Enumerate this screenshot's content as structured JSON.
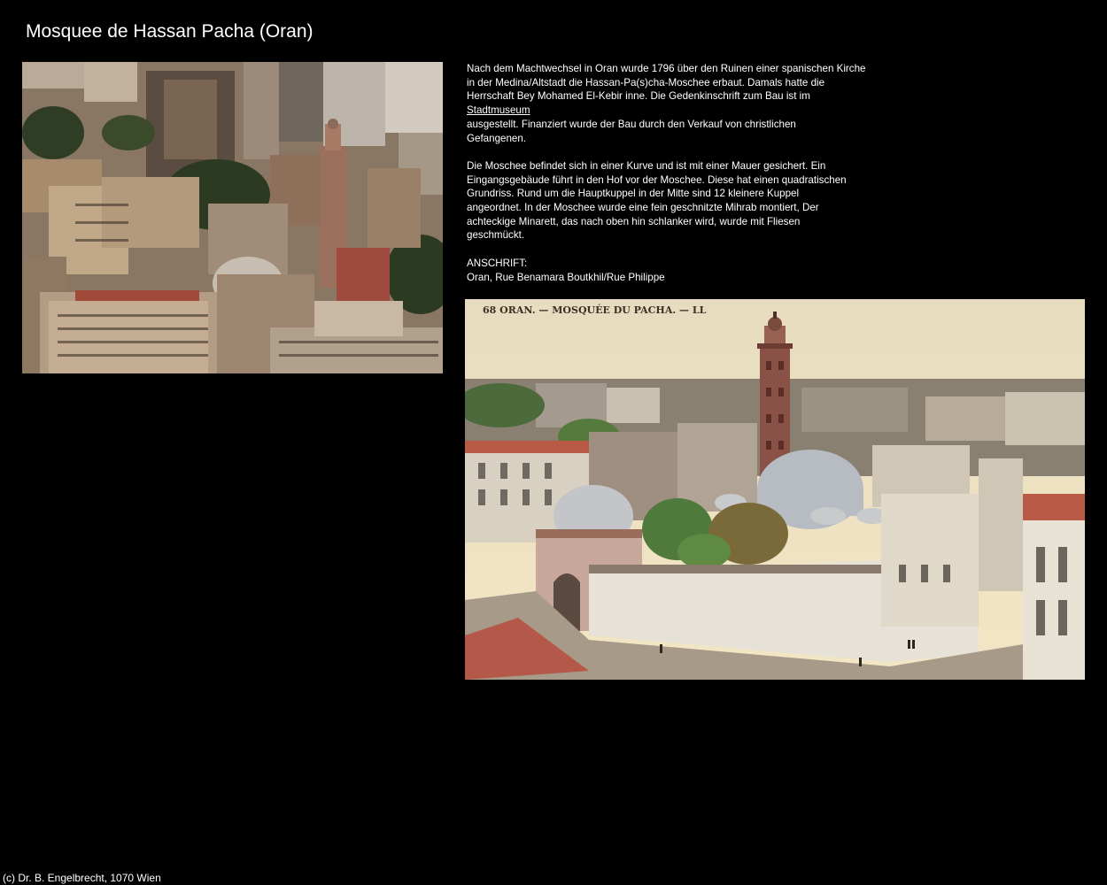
{
  "page": {
    "title": "Mosquee de Hassan Pacha (Oran)"
  },
  "photo_main": {
    "alt": "Aerial view of Oran old town with minaret"
  },
  "photo_postcard": {
    "alt": "Vintage postcard of the mosque",
    "caption": "68   ORAN. — MOSQUÉE DU PACHA. — LL"
  },
  "description": {
    "p1_line1": "Nach dem Machtwechsel in Oran wurde 1796 über den Ruinen einer spanischen Kirche",
    "p1_line2": "in der Medina/Altstadt die Hassan-Pa(s)cha-Moschee erbaut. Damals hatte die",
    "p1_line3": "Herrschaft Bey Mohamed El-Kebir inne. Die Gedenkinschrift zum Bau ist im",
    "p1_link": "Stadtmuseum",
    "p1_line4": "ausgestellt. Finanziert wurde der Bau durch den Verkauf von christlichen",
    "p1_line5": "Gefangenen.",
    "p2_line1": "Die Moschee befindet sich in einer Kurve und ist mit einer Mauer gesichert. Ein",
    "p2_line2": "Eingangsgebäude führt in den Hof vor der Moschee. Diese hat einen quadratischen",
    "p2_line3": "Grundriss. Rund um die Hauptkuppel in der Mitte sind 12 kleinere Kuppel",
    "p2_line4": "angeordnet. In der Moschee wurde eine fein geschnitzte Mihrab montiert, Der",
    "p2_line5": "achteckige Minarett, das nach oben hin schlanker wird, wurde mit Fliesen",
    "p2_line6": "geschmückt.",
    "address_label": "ANSCHRIFT:",
    "address_value": "Oran, Rue Benamara Boutkhil/Rue Philippe"
  },
  "footer": {
    "copyright": "(c) Dr. B. Engelbrecht, 1070 Wien"
  },
  "colors": {
    "background": "#000000",
    "text": "#ffffff"
  }
}
